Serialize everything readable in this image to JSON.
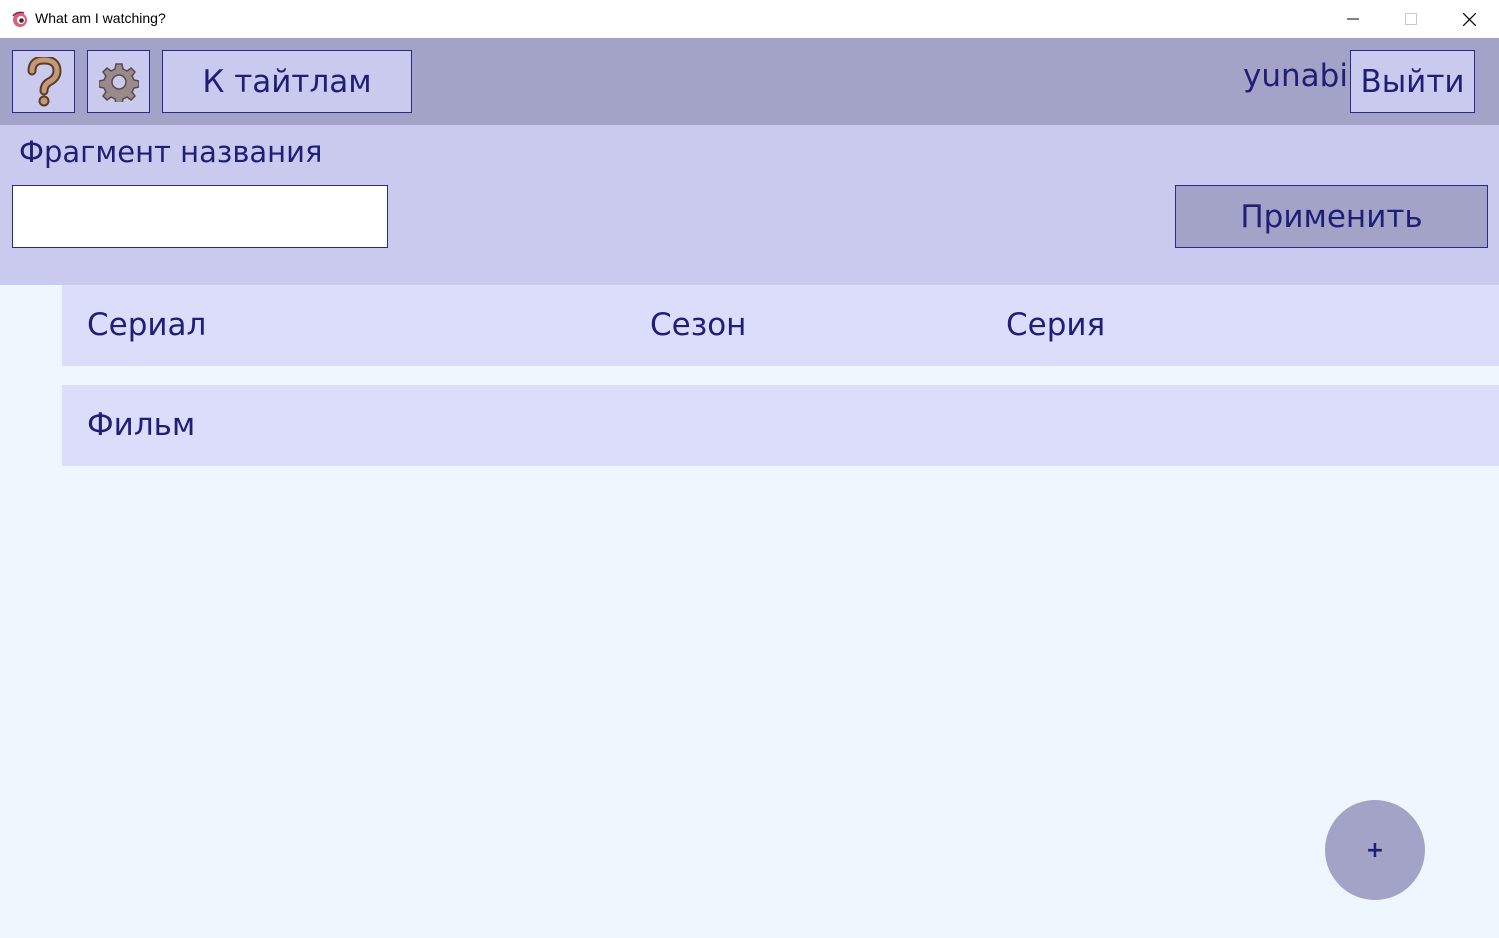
{
  "window": {
    "title": "What am I watching?",
    "controls": [
      "minimize",
      "maximize",
      "close"
    ]
  },
  "toolbar": {
    "help_icon": "question-mark-icon",
    "settings_icon": "gear-icon",
    "titles_button": "К тайтлам",
    "username": "yunabi",
    "logout_button": "Выйти"
  },
  "filter": {
    "label": "Фрагмент названия",
    "search_value": "",
    "apply_button": "Применить"
  },
  "list": {
    "rows": [
      {
        "columns": [
          "Сериал",
          "Сезон",
          "Серия"
        ]
      },
      {
        "columns": [
          "Фильм"
        ]
      }
    ]
  },
  "fab": {
    "label": "+"
  },
  "colors": {
    "toolbar_bg": "#a3a3c8",
    "filter_bg": "#cacaef",
    "row_bg": "#dcdcfb",
    "page_bg": "#eef7fd",
    "text": "#1f1f78",
    "border": "#2a2a8a"
  }
}
